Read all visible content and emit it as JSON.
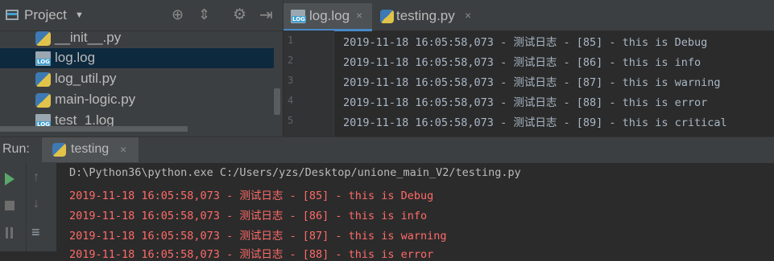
{
  "project": {
    "title": "Project",
    "files": [
      {
        "name": "__init__.py",
        "type": "py"
      },
      {
        "name": "log.log",
        "type": "log",
        "selected": true
      },
      {
        "name": "log_util.py",
        "type": "py"
      },
      {
        "name": "main-logic.py",
        "type": "py"
      },
      {
        "name": "test_1.log",
        "type": "log"
      }
    ]
  },
  "editor": {
    "tabs": [
      {
        "label": "log.log",
        "active": true
      },
      {
        "label": "testing.py",
        "active": false
      }
    ],
    "lines": [
      {
        "num": "1",
        "text": "2019-11-18 16:05:58,073 - 测试日志 - [85] - this is Debug"
      },
      {
        "num": "2",
        "text": "2019-11-18 16:05:58,073 - 测试日志 - [86] - this is info"
      },
      {
        "num": "3",
        "text": "2019-11-18 16:05:58,073 - 测试日志 - [87] - this is warning"
      },
      {
        "num": "4",
        "text": "2019-11-18 16:05:58,073 - 测试日志 - [88] - this is error"
      },
      {
        "num": "5",
        "text": "2019-11-18 16:05:58,073 - 测试日志 - [89] - this is critical"
      }
    ]
  },
  "run": {
    "label": "Run:",
    "tab": "testing",
    "command": "D:\\Python36\\python.exe C:/Users/yzs/Desktop/unione_main_V2/testing.py",
    "output": [
      "2019-11-18 16:05:58,073 - 测试日志 - [85] - this is Debug",
      "2019-11-18 16:05:58,073 - 测试日志 - [86] - this is info",
      "2019-11-18 16:05:58,073 - 测试日志 - [87] - this is warning",
      "2019-11-18 16:05:58,073 - 测试日志 - [88] - this is error"
    ]
  },
  "colors": {
    "accent": "#4a88c7",
    "error_text": "#ff6b68",
    "selection": "#0d293e"
  },
  "icons": {
    "close": "×"
  }
}
